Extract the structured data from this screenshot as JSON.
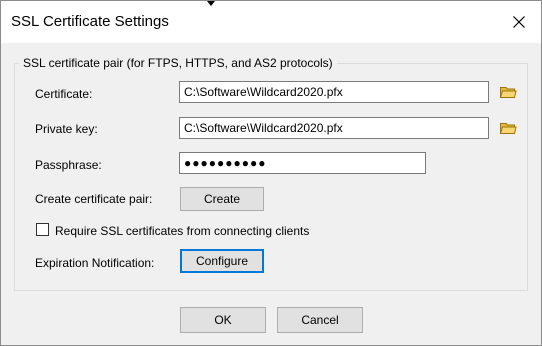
{
  "window": {
    "title": "SSL Certificate Settings"
  },
  "group": {
    "legend": "SSL certificate pair (for FTPS, HTTPS, and AS2 protocols)"
  },
  "fields": {
    "certificate_label": "Certificate:",
    "certificate_value": "C:\\Software\\Wildcard2020.pfx",
    "private_key_label": "Private key:",
    "private_key_value": "C:\\Software\\Wildcard2020.pfx",
    "passphrase_label": "Passphrase:",
    "passphrase_masked": "●●●●●●●●●●",
    "create_pair_label": "Create certificate pair:",
    "create_button": "Create",
    "require_ssl_label": "Require SSL certificates from connecting clients",
    "require_ssl_checked": false,
    "expiration_label": "Expiration Notification:",
    "configure_button": "Configure"
  },
  "footer": {
    "ok_button": "OK",
    "cancel_button": "Cancel"
  },
  "icons": {
    "browse": "folder-icon",
    "close": "close-icon"
  },
  "colors": {
    "focus_border": "#0078d7",
    "folder_fill": "#f2c94c"
  }
}
